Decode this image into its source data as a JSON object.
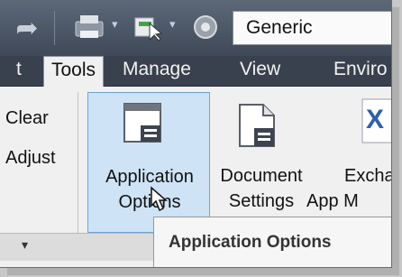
{
  "quick_access": {
    "redo_icon": "redo-arrow-icon",
    "plot_icon": "plot-icon",
    "project_icon": "project-icon",
    "appearance_icon": "appearance-icon",
    "dropdown_glyph": "▾",
    "appearance_value": "Generic"
  },
  "tabs": {
    "partial_left": "t",
    "tools": "Tools",
    "manage": "Manage",
    "view": "View",
    "environments_partial": "Enviro"
  },
  "ribbon": {
    "clear": "Clear",
    "adjust": "Adjust",
    "app_options_line1": "Application",
    "app_options_line2": "Options",
    "doc_settings_line1": "Document",
    "doc_settings_line2": "Settings",
    "exchange_line1": "Excha",
    "exchange_line2": "App M",
    "panel_expander": "▾"
  },
  "tooltip": {
    "title": "Application Options"
  },
  "colors": {
    "title_bar": "#4a5463",
    "tab_bar": "#39414e",
    "selected_button_fill": "#cfe3f6",
    "selected_button_border": "#6fa4d8"
  }
}
